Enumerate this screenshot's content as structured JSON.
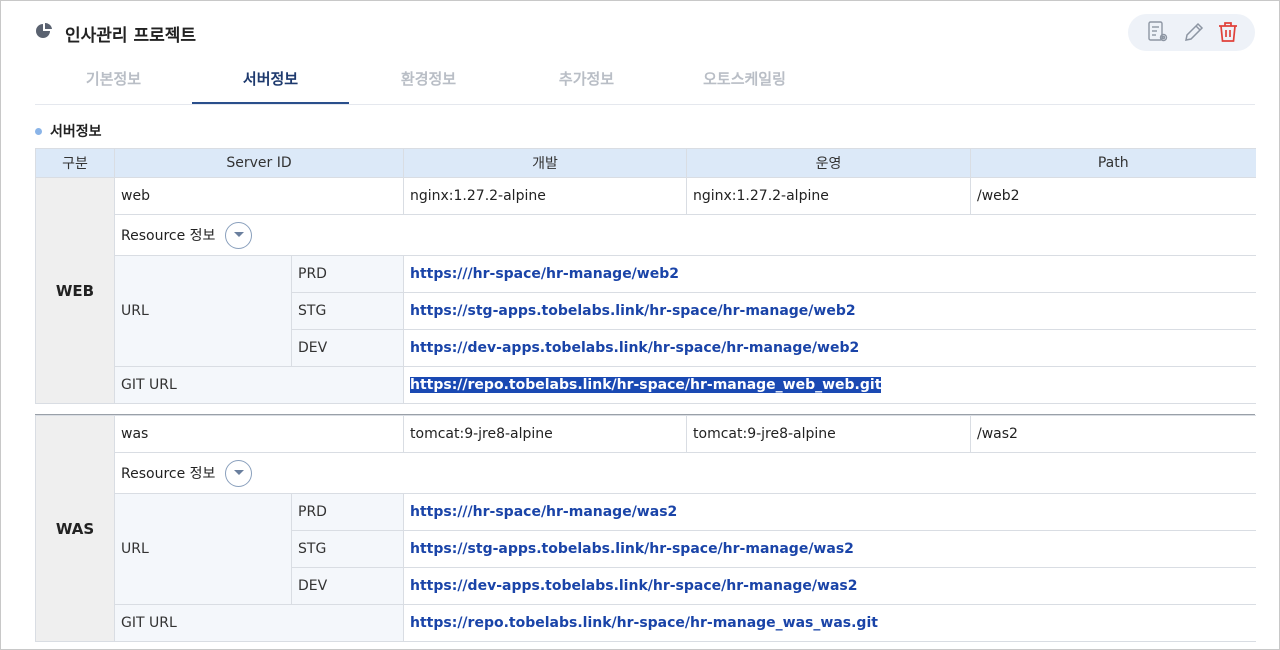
{
  "header": {
    "title": "인사관리 프로젝트"
  },
  "actions": [
    "config-doc-icon",
    "pencil-icon",
    "trash-icon"
  ],
  "colors": {
    "accent": "#1e3a6e",
    "link": "#1a44a8",
    "delete": "#e0413a",
    "header_bg": "#dce9f8"
  },
  "tabs": [
    {
      "label": "기본정보",
      "active": false
    },
    {
      "label": "서버정보",
      "active": true
    },
    {
      "label": "환경정보",
      "active": false
    },
    {
      "label": "추가정보",
      "active": false
    },
    {
      "label": "오토스케일링",
      "active": false
    }
  ],
  "section": {
    "title": "서버정보"
  },
  "table": {
    "headers": [
      "구분",
      "Server ID",
      "개발",
      "운영",
      "Path"
    ],
    "groups": [
      {
        "name": "WEB",
        "server_id": "web",
        "dev": "nginx:1.27.2-alpine",
        "prod": "nginx:1.27.2-alpine",
        "path": "/web2",
        "resource_label": "Resource 정보",
        "url_label": "URL",
        "urls": [
          {
            "env": "PRD",
            "url": "https:///hr-space/hr-manage/web2"
          },
          {
            "env": "STG",
            "url": "https://stg-apps.tobelabs.link/hr-space/hr-manage/web2"
          },
          {
            "env": "DEV",
            "url": "https://dev-apps.tobelabs.link/hr-space/hr-manage/web2"
          }
        ],
        "git_label": "GIT URL",
        "git_url": "https://repo.tobelabs.link/hr-space/hr-manage_web_web.git"
      },
      {
        "name": "WAS",
        "server_id": "was",
        "dev": "tomcat:9-jre8-alpine",
        "prod": "tomcat:9-jre8-alpine",
        "path": "/was2",
        "resource_label": "Resource 정보",
        "url_label": "URL",
        "urls": [
          {
            "env": "PRD",
            "url": "https:///hr-space/hr-manage/was2"
          },
          {
            "env": "STG",
            "url": "https://stg-apps.tobelabs.link/hr-space/hr-manage/was2"
          },
          {
            "env": "DEV",
            "url": "https://dev-apps.tobelabs.link/hr-space/hr-manage/was2"
          }
        ],
        "git_label": "GIT URL",
        "git_url": "https://repo.tobelabs.link/hr-space/hr-manage_was_was.git"
      }
    ]
  }
}
